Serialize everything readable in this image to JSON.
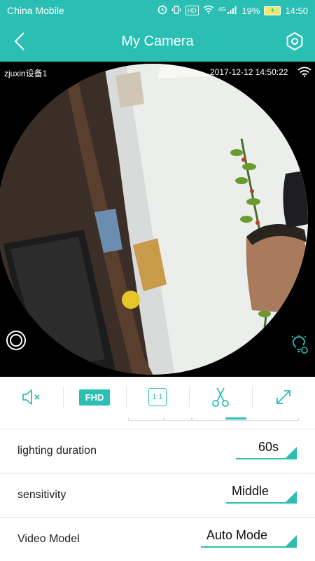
{
  "status_bar": {
    "carrier": "China Mobile",
    "network": "4G",
    "hd_badge": "HD",
    "battery_percent": "19%",
    "time": "14:50"
  },
  "nav": {
    "title": "My Camera"
  },
  "video": {
    "device_name": "zjuxin设备1",
    "timestamp": "2017-12-12 14:50:22"
  },
  "toolbar": {
    "quality_label": "FHD",
    "ratio_label": "1:1"
  },
  "settings": [
    {
      "label": "lighting duration",
      "value": "60s"
    },
    {
      "label": "sensitivity",
      "value": "Middle"
    },
    {
      "label": "Video Model",
      "value": "Auto Mode"
    }
  ],
  "colors": {
    "accent": "#2bbfb4"
  }
}
